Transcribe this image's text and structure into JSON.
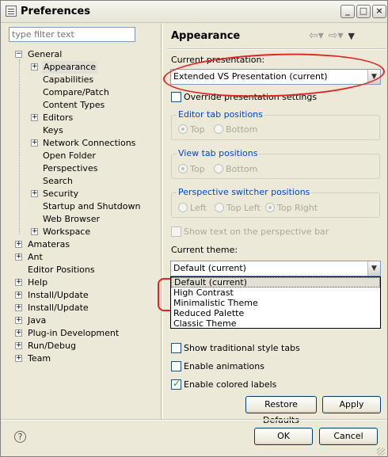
{
  "window": {
    "title": "Preferences"
  },
  "filter": {
    "placeholder": "type filter text"
  },
  "tree": {
    "general": "General",
    "appearance": "Appearance",
    "capabilities": "Capabilities",
    "compare_patch": "Compare/Patch",
    "content_types": "Content Types",
    "editors": "Editors",
    "keys": "Keys",
    "network_connections": "Network Connections",
    "open_folder": "Open Folder",
    "perspectives": "Perspectives",
    "search": "Search",
    "security": "Security",
    "startup_shutdown": "Startup and Shutdown",
    "web_browser": "Web Browser",
    "workspace": "Workspace",
    "amateras": "Amateras",
    "ant": "Ant",
    "editor_positions": "Editor Positions",
    "help": "Help",
    "install_update_1": "Install/Update",
    "install_update_2": "Install/Update",
    "java": "Java",
    "plugin_development": "Plug-in Development",
    "run_debug": "Run/Debug",
    "team": "Team"
  },
  "page": {
    "title": "Appearance",
    "current_presentation_label": "Current presentation:",
    "current_presentation_value": "Extended VS Presentation (current)",
    "override_label": "Override presentation settings",
    "editor_tab_group": "Editor tab positions",
    "editor_top": "Top",
    "editor_bottom": "Bottom",
    "view_tab_group": "View tab positions",
    "view_top": "Top",
    "view_bottom": "Bottom",
    "persp_group": "Perspective switcher positions",
    "persp_left": "Left",
    "persp_top_left": "Top Left",
    "persp_top_right": "Top Right",
    "show_text_label": "Show text on the perspective bar",
    "current_theme_label": "Current theme:",
    "current_theme_value": "Default (current)",
    "theme_options": [
      "Default (current)",
      "High Contrast",
      "Minimalistic Theme",
      "Reduced Palette",
      "Classic Theme"
    ],
    "show_traditional_label": "Show traditional style tabs",
    "enable_animations_label": "Enable animations",
    "enable_colored_label": "Enable colored labels",
    "restore_defaults": "Restore Defaults",
    "apply": "Apply"
  },
  "footer": {
    "ok": "OK",
    "cancel": "Cancel"
  },
  "checks": {
    "override": false,
    "show_text": false,
    "traditional": false,
    "animations": false,
    "colored_labels": true
  },
  "colors": {
    "annotation": "#e52222",
    "group_title": "#0046d5",
    "window_bg": "#ece9d8"
  }
}
